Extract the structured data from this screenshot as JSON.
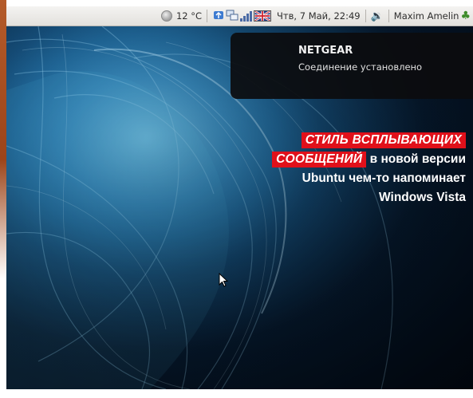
{
  "panel": {
    "weather": "12 °C",
    "clock": "Чтв, 7 Май, 22:49",
    "user": "Maxim Amelin"
  },
  "notification": {
    "title": "NETGEAR",
    "body": "Соединение установлено"
  },
  "caption": {
    "highlight_1": "СТИЛЬ ВСПЛЫВАЮЩИХ",
    "highlight_2": "СООБЩЕНИЙ",
    "text_1": " в новой версии",
    "text_2": "Ubuntu чем-то напоминает",
    "text_3": "Windows Vista"
  },
  "icons": {
    "weather": "weather-icon",
    "network": "network-icon",
    "signal": "signal-strength-icon",
    "keyboard_layout": "uk-flag-icon",
    "volume": "volume-icon",
    "shutdown": "shutdown-icon",
    "pointer": "mouse-pointer-icon"
  },
  "colors": {
    "caption_highlight": "#e0101a",
    "notification_bg": "#0c0c0e",
    "wallpaper_accent": "#5fb4de"
  }
}
